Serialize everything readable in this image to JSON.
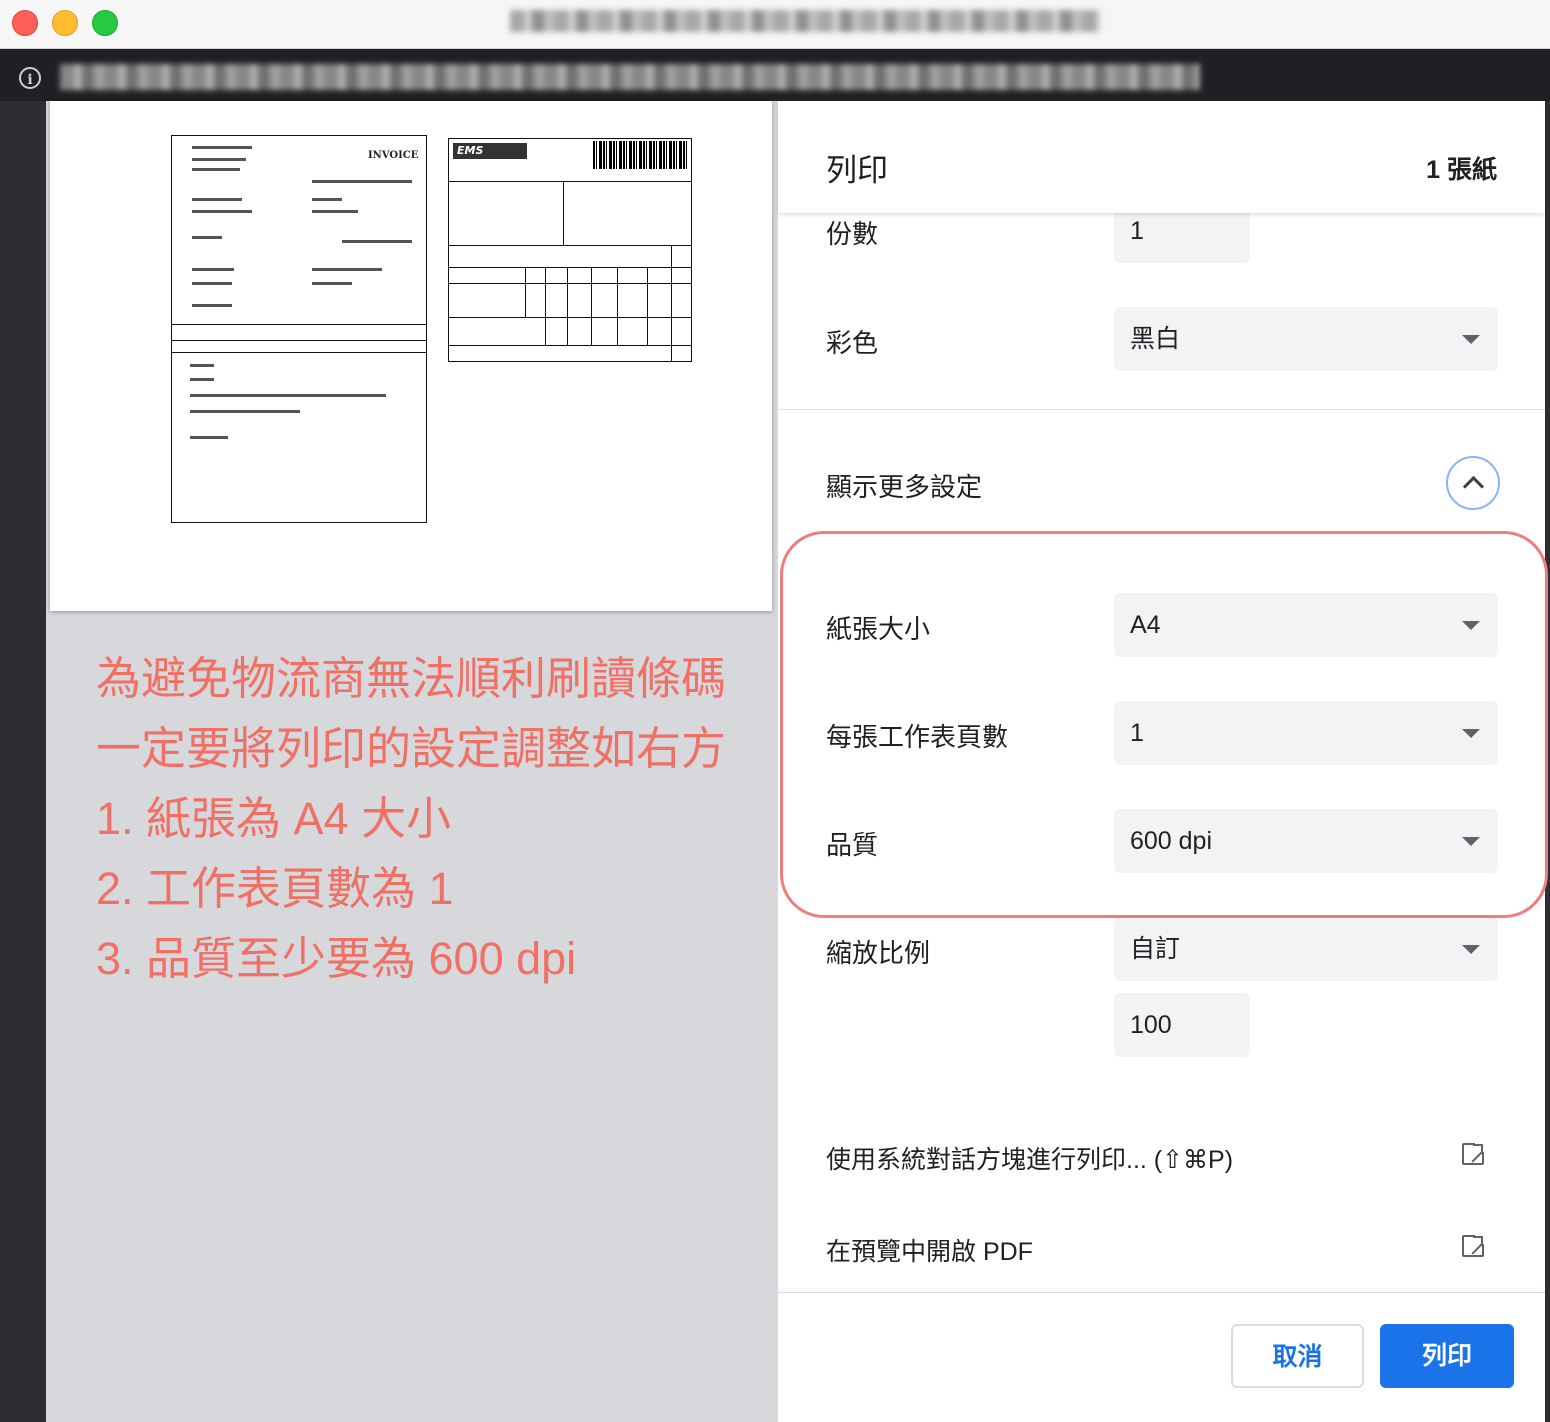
{
  "window": {
    "title": ""
  },
  "print_panel": {
    "title": "列印",
    "sheet_count": "1 張紙",
    "copies": {
      "label": "份數",
      "value": "1"
    },
    "color": {
      "label": "彩色",
      "value": "黑白"
    },
    "more_settings": {
      "label": "顯示更多設定"
    },
    "paper_size": {
      "label": "紙張大小",
      "value": "A4"
    },
    "pages_per_sheet": {
      "label": "每張工作表頁數",
      "value": "1"
    },
    "quality": {
      "label": "品質",
      "value": "600 dpi"
    },
    "scale": {
      "label": "縮放比例",
      "value": "自訂",
      "custom_value": "100"
    },
    "system_dialog_link": "使用系統對話方塊進行列印... (⇧⌘P)",
    "open_pdf_link": "在預覽中開啟 PDF",
    "cancel_label": "取消",
    "print_label": "列印"
  },
  "preview": {
    "invoice_title": "INVOICE",
    "ems_logo": "EMS"
  },
  "annotation": {
    "lines": [
      "為避免物流商無法順利刷讀條碼",
      "一定要將列印的設定調整如右方",
      "1. 紙張為 A4 大小",
      "2. 工作表頁數為 1",
      "3. 品質至少要為 600 dpi"
    ],
    "color": "#f07066"
  },
  "colors": {
    "accent": "#1a73e8",
    "highlight": "#ef7d7d"
  }
}
